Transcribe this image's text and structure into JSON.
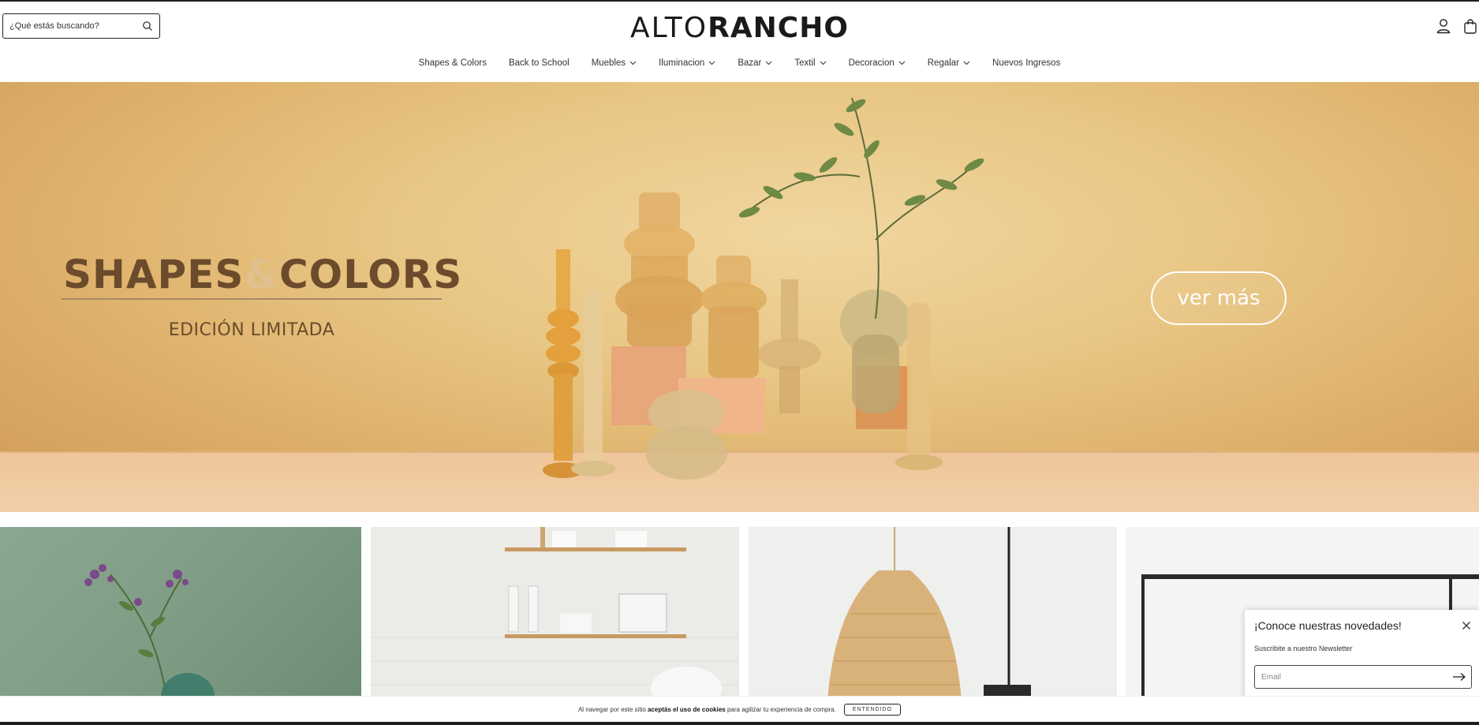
{
  "search": {
    "placeholder": "¿Qué estás buscando?"
  },
  "logo": {
    "thin": "ALTO",
    "bold": "RANCHO"
  },
  "header_icons": [
    "user-icon",
    "shopping-bag-icon"
  ],
  "nav": [
    {
      "label": "Shapes & Colors",
      "has_dropdown": false
    },
    {
      "label": "Back to School",
      "has_dropdown": false
    },
    {
      "label": "Muebles",
      "has_dropdown": true
    },
    {
      "label": "Iluminacion",
      "has_dropdown": true
    },
    {
      "label": "Bazar",
      "has_dropdown": true
    },
    {
      "label": "Textil",
      "has_dropdown": true
    },
    {
      "label": "Decoracion",
      "has_dropdown": true
    },
    {
      "label": "Regalar",
      "has_dropdown": true
    },
    {
      "label": "Nuevos Ingresos",
      "has_dropdown": false
    }
  ],
  "hero": {
    "title_part1": "SHAPES",
    "title_amp": "&",
    "title_part2": "COLORS",
    "subtitle": "EDICIÓN LIMITADA",
    "cta": "ver más"
  },
  "newsletter": {
    "title": "¡Conoce nuestras novedades!",
    "subtitle": "Suscribite a nuestro Newsletter",
    "email_placeholder": "Email"
  },
  "cookie": {
    "text_before": "Al navegar por este sitio",
    "text_bold": "aceptás el uso de cookies",
    "text_after": "para agilizar tu experiencia de compra.",
    "button": "ENTENDIDO"
  },
  "colors": {
    "hero_bg": "#e9c785",
    "hero_text": "#6b4b2c",
    "tile_green": "#7c9a82"
  }
}
